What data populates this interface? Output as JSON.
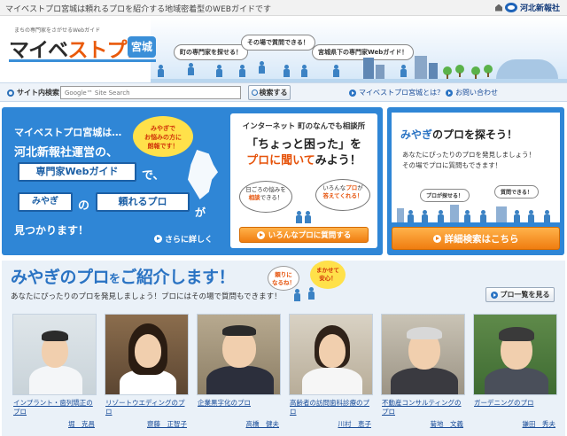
{
  "topbar": {
    "tagline": "マイベストプロ宮城は頼れるプロを紹介する地域密着型のWEBガイドです",
    "newspaper": "河北新報社"
  },
  "header": {
    "logo_small": "まちの専門家をさがせるWebガイド",
    "logo_main_a": "マイベ",
    "logo_main_b": "ストプロ",
    "logo_region": "宮城",
    "bubble1": "町の専門家を探せる！",
    "bubble2": "その場で質問できる！",
    "bubble3": "宮城県下の専門家Webガイド！"
  },
  "search": {
    "label": "サイト内検索",
    "placeholder": "Google™ Site Search",
    "button": "検索する",
    "link_about": "マイベストプロ宮城とは？",
    "link_contact": "お問い合わせ"
  },
  "hero": {
    "line1": "マイベストプロ宮城は…",
    "line2": "河北新報社運営の、",
    "box1": "専門家Webガイド",
    "de": "で、",
    "box2": "みやぎ",
    "no": "の",
    "box3": "頼れるプロ",
    "ga": "が",
    "line_end": "見つかります！",
    "bubble": "みやぎで\nお悩みの方に\n朗報です！",
    "more": "さらに詳しく"
  },
  "qcard": {
    "title": "インターネット 町のなんでも相談所",
    "headline1": "「ちょっと困った」を",
    "headline2_a": "プロに聞いて",
    "headline2_b": "みよう！",
    "bubble_left_a": "日ごろの悩みを",
    "bubble_left_b": "相談",
    "bubble_left_c": "できる！",
    "bubble_right_a": "いろんな",
    "bubble_right_b": "プロ",
    "bubble_right_c": "が",
    "bubble_right_d": "答えてくれる！",
    "button": "いろんなプロに質問する"
  },
  "find": {
    "title_a": "みやぎ",
    "title_b": "のプロを探そう！",
    "text1": "あなたにぴったりのプロを発見しましょう！",
    "text2": "その場でプロに質問もできます！",
    "bubble1": "プロが探せる！",
    "bubble2": "質問できる！",
    "button": "詳細検索はこちら"
  },
  "intro": {
    "heading_a": "みやぎのプロ",
    "heading_b": "を",
    "heading_c": "ご紹介します！",
    "sub": "あなたにぴったりのプロを発見しましょう！プロにはその場で質問もできます！",
    "bubble1": "頼りに\nなるね！",
    "bubble2": "まかせて\n安心！",
    "list_button": "プロ一覧を見る",
    "cards": [
      {
        "category": "インプラント・歯列矯正のプロ",
        "name": "堀　克昌"
      },
      {
        "category": "リゾートウエディングのプロ",
        "name": "齋藤　正智子"
      },
      {
        "category": "企業黒字化のプロ",
        "name": "高橋　健夫"
      },
      {
        "category": "高齢者の訪問歯科診療のプロ",
        "name": "川村　恵子"
      },
      {
        "category": "不動産コンサルティングのプロ",
        "name": "菊地　文義"
      },
      {
        "category": "ガーデニングのプロ",
        "name": "鎌田　秀夫"
      }
    ]
  },
  "colors": {
    "brand_blue": "#2f86d6",
    "accent_orange": "#f07d10",
    "link_blue": "#1a4d99"
  }
}
